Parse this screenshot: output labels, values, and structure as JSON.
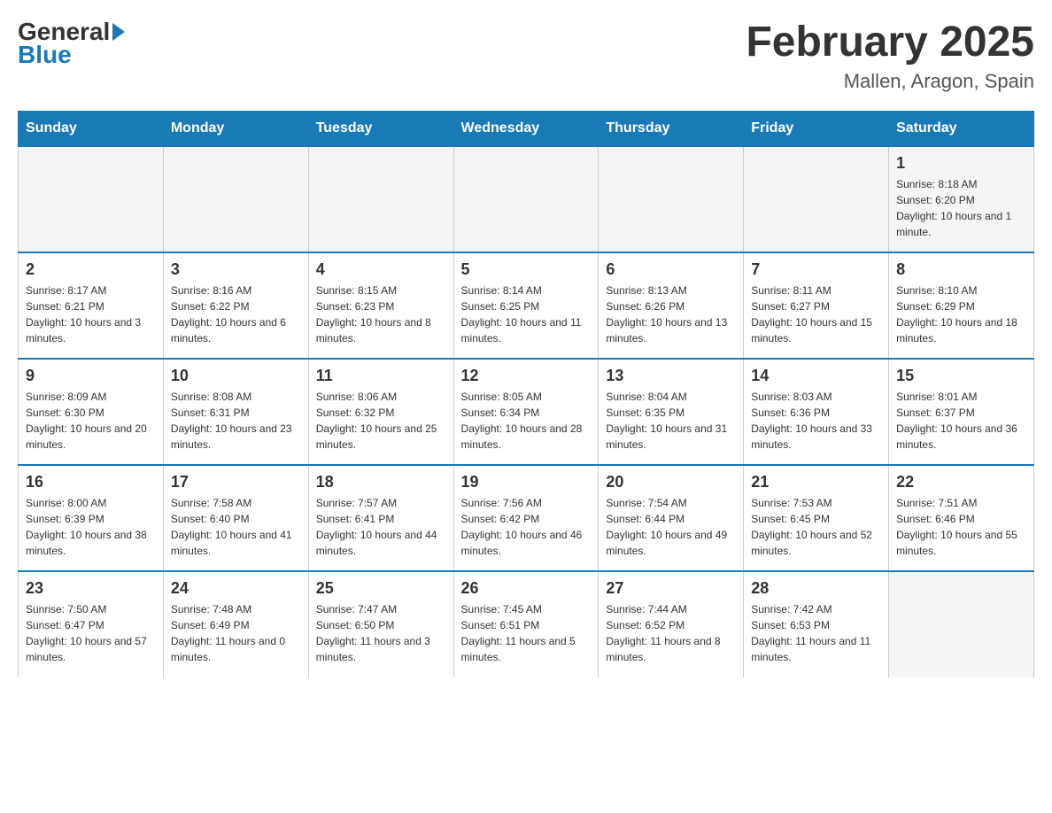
{
  "logo": {
    "general": "General",
    "blue": "Blue"
  },
  "title": "February 2025",
  "location": "Mallen, Aragon, Spain",
  "weekdays": [
    "Sunday",
    "Monday",
    "Tuesday",
    "Wednesday",
    "Thursday",
    "Friday",
    "Saturday"
  ],
  "weeks": [
    [
      {
        "day": "",
        "info": ""
      },
      {
        "day": "",
        "info": ""
      },
      {
        "day": "",
        "info": ""
      },
      {
        "day": "",
        "info": ""
      },
      {
        "day": "",
        "info": ""
      },
      {
        "day": "",
        "info": ""
      },
      {
        "day": "1",
        "info": "Sunrise: 8:18 AM\nSunset: 6:20 PM\nDaylight: 10 hours and 1 minute."
      }
    ],
    [
      {
        "day": "2",
        "info": "Sunrise: 8:17 AM\nSunset: 6:21 PM\nDaylight: 10 hours and 3 minutes."
      },
      {
        "day": "3",
        "info": "Sunrise: 8:16 AM\nSunset: 6:22 PM\nDaylight: 10 hours and 6 minutes."
      },
      {
        "day": "4",
        "info": "Sunrise: 8:15 AM\nSunset: 6:23 PM\nDaylight: 10 hours and 8 minutes."
      },
      {
        "day": "5",
        "info": "Sunrise: 8:14 AM\nSunset: 6:25 PM\nDaylight: 10 hours and 11 minutes."
      },
      {
        "day": "6",
        "info": "Sunrise: 8:13 AM\nSunset: 6:26 PM\nDaylight: 10 hours and 13 minutes."
      },
      {
        "day": "7",
        "info": "Sunrise: 8:11 AM\nSunset: 6:27 PM\nDaylight: 10 hours and 15 minutes."
      },
      {
        "day": "8",
        "info": "Sunrise: 8:10 AM\nSunset: 6:29 PM\nDaylight: 10 hours and 18 minutes."
      }
    ],
    [
      {
        "day": "9",
        "info": "Sunrise: 8:09 AM\nSunset: 6:30 PM\nDaylight: 10 hours and 20 minutes."
      },
      {
        "day": "10",
        "info": "Sunrise: 8:08 AM\nSunset: 6:31 PM\nDaylight: 10 hours and 23 minutes."
      },
      {
        "day": "11",
        "info": "Sunrise: 8:06 AM\nSunset: 6:32 PM\nDaylight: 10 hours and 25 minutes."
      },
      {
        "day": "12",
        "info": "Sunrise: 8:05 AM\nSunset: 6:34 PM\nDaylight: 10 hours and 28 minutes."
      },
      {
        "day": "13",
        "info": "Sunrise: 8:04 AM\nSunset: 6:35 PM\nDaylight: 10 hours and 31 minutes."
      },
      {
        "day": "14",
        "info": "Sunrise: 8:03 AM\nSunset: 6:36 PM\nDaylight: 10 hours and 33 minutes."
      },
      {
        "day": "15",
        "info": "Sunrise: 8:01 AM\nSunset: 6:37 PM\nDaylight: 10 hours and 36 minutes."
      }
    ],
    [
      {
        "day": "16",
        "info": "Sunrise: 8:00 AM\nSunset: 6:39 PM\nDaylight: 10 hours and 38 minutes."
      },
      {
        "day": "17",
        "info": "Sunrise: 7:58 AM\nSunset: 6:40 PM\nDaylight: 10 hours and 41 minutes."
      },
      {
        "day": "18",
        "info": "Sunrise: 7:57 AM\nSunset: 6:41 PM\nDaylight: 10 hours and 44 minutes."
      },
      {
        "day": "19",
        "info": "Sunrise: 7:56 AM\nSunset: 6:42 PM\nDaylight: 10 hours and 46 minutes."
      },
      {
        "day": "20",
        "info": "Sunrise: 7:54 AM\nSunset: 6:44 PM\nDaylight: 10 hours and 49 minutes."
      },
      {
        "day": "21",
        "info": "Sunrise: 7:53 AM\nSunset: 6:45 PM\nDaylight: 10 hours and 52 minutes."
      },
      {
        "day": "22",
        "info": "Sunrise: 7:51 AM\nSunset: 6:46 PM\nDaylight: 10 hours and 55 minutes."
      }
    ],
    [
      {
        "day": "23",
        "info": "Sunrise: 7:50 AM\nSunset: 6:47 PM\nDaylight: 10 hours and 57 minutes."
      },
      {
        "day": "24",
        "info": "Sunrise: 7:48 AM\nSunset: 6:49 PM\nDaylight: 11 hours and 0 minutes."
      },
      {
        "day": "25",
        "info": "Sunrise: 7:47 AM\nSunset: 6:50 PM\nDaylight: 11 hours and 3 minutes."
      },
      {
        "day": "26",
        "info": "Sunrise: 7:45 AM\nSunset: 6:51 PM\nDaylight: 11 hours and 5 minutes."
      },
      {
        "day": "27",
        "info": "Sunrise: 7:44 AM\nSunset: 6:52 PM\nDaylight: 11 hours and 8 minutes."
      },
      {
        "day": "28",
        "info": "Sunrise: 7:42 AM\nSunset: 6:53 PM\nDaylight: 11 hours and 11 minutes."
      },
      {
        "day": "",
        "info": ""
      }
    ]
  ]
}
